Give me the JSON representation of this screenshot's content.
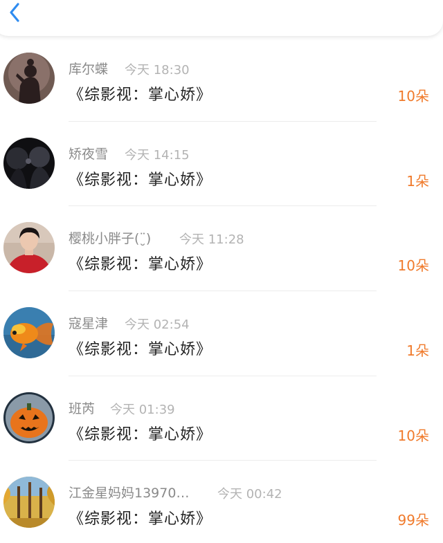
{
  "header": {
    "back_icon": "chevron-left-icon",
    "accent_color": "#2f8cf0"
  },
  "records": [
    {
      "name": "库尔蝶",
      "time": "今天 18:30",
      "title": "《综影视：掌心娇》",
      "amount": "10朵",
      "avatar": "silhouette-avatar"
    },
    {
      "name": "矫夜雪",
      "time": "今天 14:15",
      "title": "《综影视：掌心娇》",
      "amount": "1朵",
      "avatar": "couple-avatar"
    },
    {
      "name": "樱桃小胖子(¨̮)",
      "time": "今天 11:28",
      "title": "《综影视：掌心娇》",
      "amount": "10朵",
      "avatar": "person-avatar"
    },
    {
      "name": "寇星津",
      "time": "今天 02:54",
      "title": "《综影视：掌心娇》",
      "amount": "1朵",
      "avatar": "goldfish-avatar"
    },
    {
      "name": "班芮",
      "time": "今天 01:39",
      "title": "《综影视：掌心娇》",
      "amount": "10朵",
      "avatar": "pumpkin-avatar"
    },
    {
      "name": "江金星妈妈13970…",
      "time": "今天 00:42",
      "title": "《综影视：掌心娇》",
      "amount": "99朵",
      "avatar": "autumn-trees-avatar"
    }
  ],
  "colors": {
    "amount": "#f07a2b",
    "name": "#8a8a8a",
    "time": "#b3b3b3",
    "title": "#222222"
  }
}
